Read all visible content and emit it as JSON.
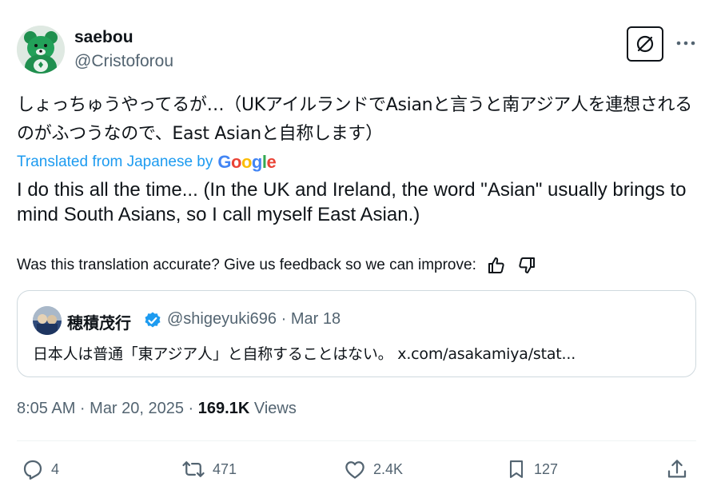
{
  "author": {
    "name": "saebou",
    "handle": "@Cristoforou"
  },
  "tweet": {
    "original_text": "しょっちゅうやってるが…（UKアイルランドでAsianと言うと南アジア人を連想されるのがふつうなので、East Asianと自称します）",
    "translated_label": "Translated from Japanese by",
    "translator": "Google",
    "translated_text": "I do this all the time... (In the UK and Ireland, the word \"Asian\" usually brings to mind South Asians, so I call myself East Asian.)",
    "feedback_prompt": "Was this translation accurate? Give us feedback so we can improve:"
  },
  "quote": {
    "name": "穂積茂行",
    "handle": "@shigeyuki696",
    "separator": " · ",
    "date": "Mar 18",
    "text": "日本人は普通「東アジア人」と自称することはない。 x.com/asakamiya/stat..."
  },
  "meta": {
    "time": "8:05 AM · Mar 20, 2025 · ",
    "views_count": "169.1K",
    "views_label": " Views"
  },
  "actions": {
    "replies": "4",
    "reposts": "471",
    "likes": "2.4K",
    "bookmarks": "127"
  },
  "colors": {
    "accent": "#1d9bf0",
    "secondary_text": "#536471",
    "primary_text": "#0f1419",
    "border": "#cfd9de"
  },
  "icons": [
    "grok-icon",
    "more-icon",
    "thumbs-up-icon",
    "thumbs-down-icon",
    "verified-badge-icon",
    "reply-icon",
    "repost-icon",
    "like-icon",
    "bookmark-icon",
    "share-icon"
  ]
}
